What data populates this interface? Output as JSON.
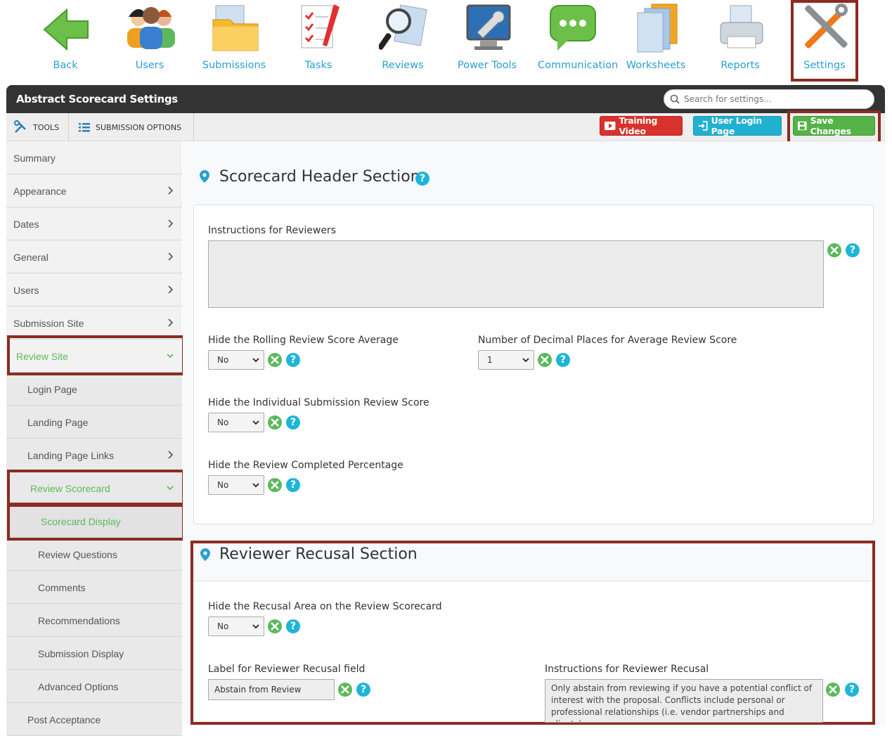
{
  "topnav": {
    "items": [
      {
        "label": "Back",
        "icon": "back-arrow-icon"
      },
      {
        "label": "Users",
        "icon": "users-icon"
      },
      {
        "label": "Submissions",
        "icon": "folder-icon"
      },
      {
        "label": "Tasks",
        "icon": "checklist-icon"
      },
      {
        "label": "Reviews",
        "icon": "magnifier-icon"
      },
      {
        "label": "Power Tools",
        "icon": "monitor-wrench-icon"
      },
      {
        "label": "Communication",
        "icon": "chat-bubble-icon"
      },
      {
        "label": "Worksheets",
        "icon": "documents-icon"
      },
      {
        "label": "Reports",
        "icon": "printer-icon"
      },
      {
        "label": "Settings",
        "icon": "tools-icon"
      }
    ],
    "active": "Settings"
  },
  "header": {
    "title": "Abstract Scorecard Settings",
    "search_placeholder": "Search for settings..."
  },
  "toolbar": {
    "tools_label": "TOOLS",
    "submission_options_label": "SUBMISSION OPTIONS",
    "training_video_label": "Training Video",
    "user_login_label": "User Login Page",
    "save_label": "Save Changes"
  },
  "sidebar": {
    "summary": "Summary",
    "appearance": "Appearance",
    "dates": "Dates",
    "general": "General",
    "users": "Users",
    "submission_site": "Submission Site",
    "review_site": "Review Site",
    "login_page": "Login Page",
    "landing_page": "Landing Page",
    "landing_page_links": "Landing Page Links",
    "review_scorecard": "Review Scorecard",
    "scorecard_display": "Scorecard Display",
    "review_questions": "Review Questions",
    "comments": "Comments",
    "recommendations": "Recommendations",
    "submission_display": "Submission Display",
    "advanced_options": "Advanced Options",
    "post_acceptance": "Post Acceptance"
  },
  "header_section": {
    "title": "Scorecard Header Section",
    "instructions_label": "Instructions for Reviewers",
    "instructions_value": "",
    "hide_rolling_label": "Hide the Rolling Review Score Average",
    "hide_rolling_value": "No",
    "decimal_label": "Number of Decimal Places for Average Review Score",
    "decimal_value": "1",
    "hide_individual_label": "Hide the Individual Submission Review Score",
    "hide_individual_value": "No",
    "hide_completed_label": "Hide the Review Completed Percentage",
    "hide_completed_value": "No"
  },
  "recusal_section": {
    "title": "Reviewer Recusal Section",
    "hide_area_label": "Hide the Recusal Area on the Review Scorecard",
    "hide_area_value": "No",
    "label_field_label": "Label for Reviewer Recusal field",
    "label_field_value": "Abstain from Review",
    "instructions_label": "Instructions for Reviewer Recusal",
    "instructions_value": "Only abstain from reviewing if you have a potential conflict of interest with the proposal. Conflicts include personal or professional relationships (i.e. vendor partnerships and clients)"
  },
  "help_glyph": "?",
  "colors": {
    "accent_blue": "#2a9fd0",
    "highlight": "#8b2c22",
    "green": "#5cb85c",
    "red": "#d9312b",
    "teal": "#22b0d0"
  }
}
